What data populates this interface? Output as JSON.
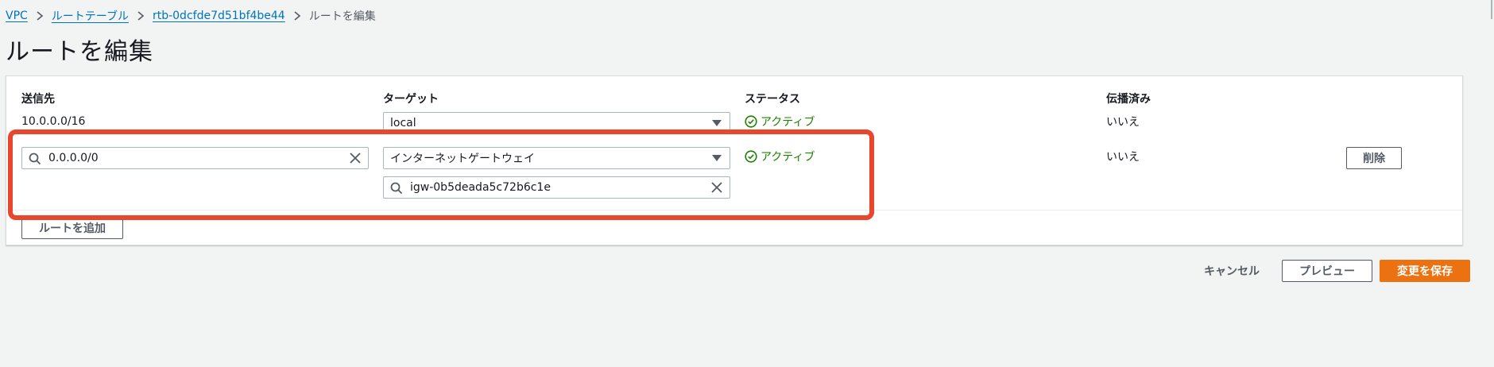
{
  "breadcrumb": {
    "vpc": "VPC",
    "route_tables": "ルートテーブル",
    "rtb_id": "rtb-0dcfde7d51bf4be44",
    "current": "ルートを編集"
  },
  "page_title": "ルートを編集",
  "table": {
    "headers": {
      "destination": "送信先",
      "target": "ターゲット",
      "status": "ステータス",
      "propagated": "伝播済み"
    },
    "rows": [
      {
        "destination": "10.0.0.0/16",
        "target": "local",
        "status": "アクティブ",
        "propagated": "いいえ"
      },
      {
        "destination": "0.0.0.0/0",
        "target": "インターネットゲートウェイ",
        "target_id": "igw-0b5deada5c72b6c1e",
        "status": "アクティブ",
        "propagated": "いいえ",
        "remove_label": "削除"
      }
    ],
    "add_route_label": "ルートを追加"
  },
  "footer": {
    "cancel_label": "キャンセル",
    "preview_label": "プレビュー",
    "save_label": "変更を保存"
  },
  "colors": {
    "link": "#0073bb",
    "status_active": "#1d8102",
    "primary": "#ec7211",
    "highlight": "#e8462d"
  },
  "icons": {
    "breadcrumb_separator": "chevron-right-icon",
    "status": "check-circle-icon",
    "search": "search-icon",
    "clear": "close-icon",
    "dropdown": "caret-down-icon"
  }
}
